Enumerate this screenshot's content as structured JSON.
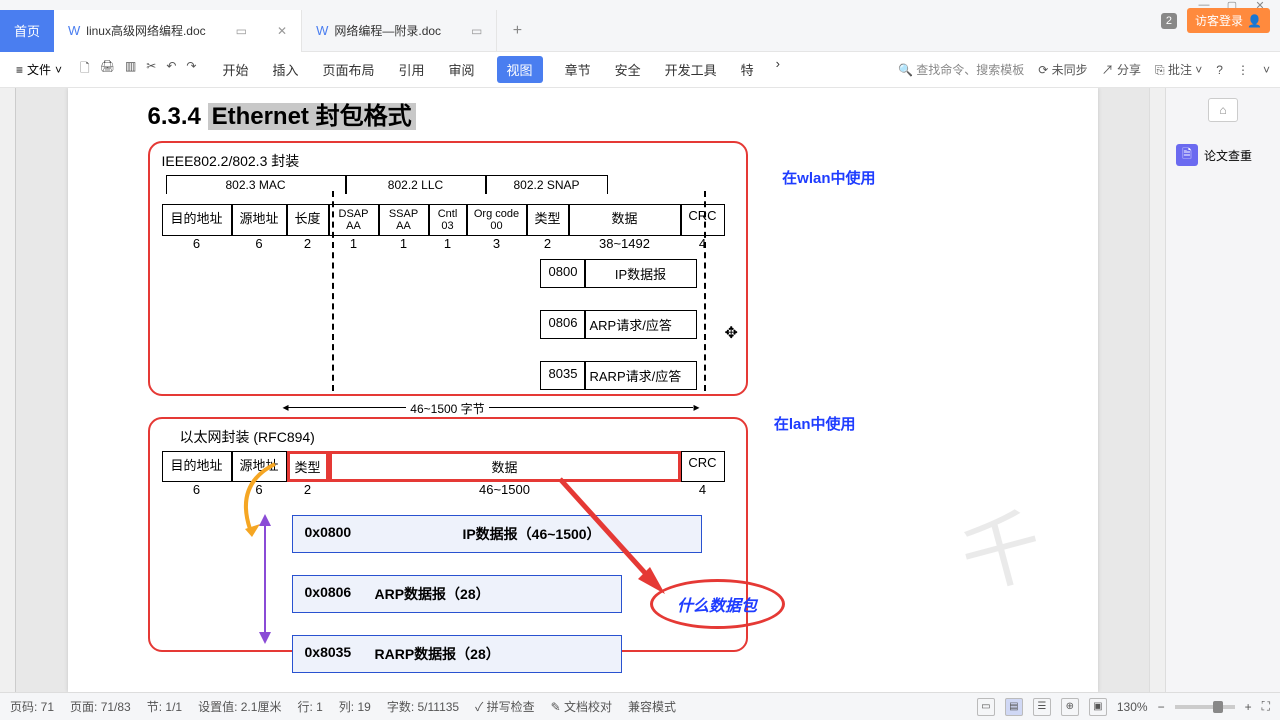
{
  "window": {
    "min": "—",
    "max": "▢",
    "close": "✕"
  },
  "tabs": {
    "home": "首页",
    "t1": "linux高级网络编程.doc",
    "t2": "网络编程—附录.doc",
    "badge": "2",
    "login": "访客登录"
  },
  "ribbon": {
    "file": "文件",
    "menus": [
      "开始",
      "插入",
      "页面布局",
      "引用",
      "审阅",
      "视图",
      "章节",
      "安全",
      "开发工具",
      "特"
    ],
    "active_menu_index": 5,
    "search": "查找命令、搜索模板",
    "unsync": "未同步",
    "share": "分享",
    "annot": "批注"
  },
  "sidepanel": {
    "item1": "论文查重"
  },
  "doc": {
    "heading_num": "6.3.4",
    "heading_txt": "Ethernet 封包格式",
    "fig1": {
      "title": "IEEE802.2/802.3 封装",
      "segs": [
        "802.3 MAC",
        "802.2 LLC",
        "802.2 SNAP"
      ],
      "note": "在wlan中使用",
      "row1": [
        "目的地址",
        "源地址",
        "长度",
        "DSAP AA",
        "SSAP AA",
        "Cntl 03",
        "Org code 00",
        "类型",
        "数据",
        "CRC"
      ],
      "sizes": [
        "6",
        "6",
        "2",
        "1",
        "1",
        "1",
        "3",
        "2",
        "38~1492",
        "4"
      ],
      "sub": [
        {
          "code": "0800",
          "name": "IP数据报"
        },
        {
          "code": "0806",
          "name": "ARP请求/应答"
        },
        {
          "code": "8035",
          "name": "RARP请求/应答"
        }
      ]
    },
    "midlen": "46~1500 字节",
    "fig2": {
      "title": "以太网封装 (RFC894)",
      "note": "在lan中使用",
      "row": [
        "目的地址",
        "源地址",
        "类型",
        "数据",
        "CRC"
      ],
      "sizes": [
        "6",
        "6",
        "2",
        "46~1500",
        "4"
      ],
      "payloads": [
        {
          "code": "0x0800",
          "name": "IP数据报（46~1500）"
        },
        {
          "code": "0x0806",
          "name": "ARP数据报（28）"
        },
        {
          "code": "0x8035",
          "name": "RARP数据报（28）"
        }
      ],
      "q": "什么数据包"
    }
  },
  "status": {
    "page_no": "页码: 71",
    "page": "页面: 71/83",
    "sec": "节: 1/1",
    "set": "设置值: 2.1厘米",
    "row": "行: 1",
    "col": "列: 19",
    "words": "字数: 5/11135",
    "spell": "拼写检查",
    "proof": "文档校对",
    "compat": "兼容模式",
    "zoom": "130%"
  }
}
